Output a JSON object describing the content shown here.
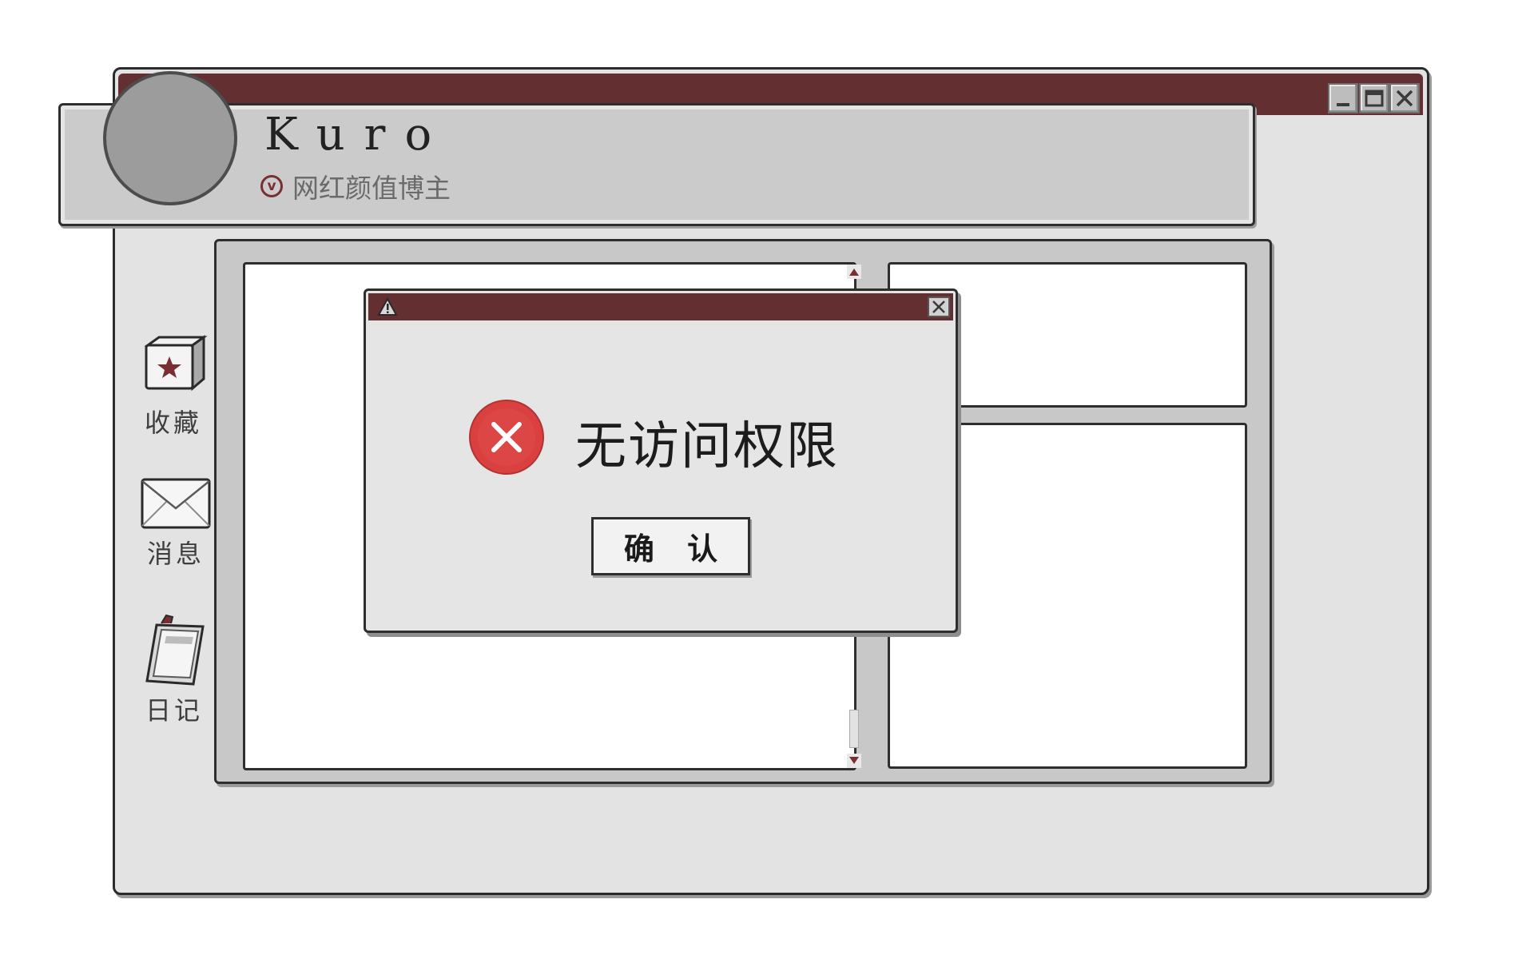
{
  "window": {
    "title_bar_color": "#632f30",
    "controls": [
      "minimize-icon",
      "maximize-icon",
      "close-icon"
    ]
  },
  "profile": {
    "name": "Kuro",
    "badge_letter": "v",
    "badge_text": "网红颜值博主",
    "accent_color": "#7a2e33"
  },
  "sidebar": {
    "items": [
      {
        "icon": "favorite-box-icon",
        "label": "收藏"
      },
      {
        "icon": "envelope-icon",
        "label": "消息"
      },
      {
        "icon": "notebook-icon",
        "label": "日记"
      }
    ]
  },
  "dialog": {
    "title_icon": "warning-icon",
    "status_icon": "error-icon",
    "message": "无访问权限",
    "confirm_label": "确 认",
    "error_color": "#d9403f"
  }
}
